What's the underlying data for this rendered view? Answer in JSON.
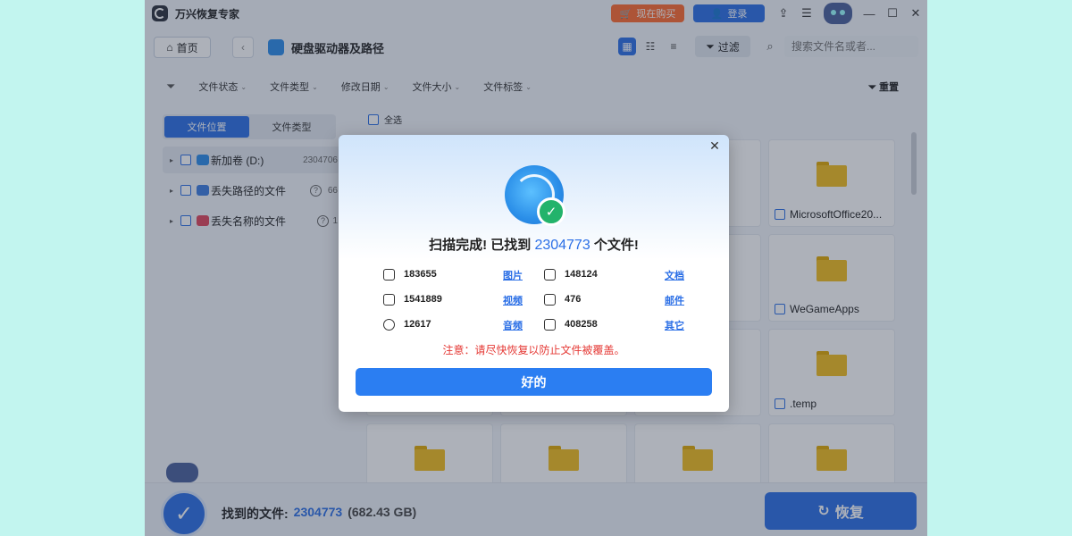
{
  "app": {
    "title": "万兴恢复专家",
    "buy_label": "现在购买",
    "login_label": "登录"
  },
  "nav": {
    "home_label": "首页",
    "title": "硬盘驱动器及路径",
    "filter_label": "过滤",
    "search_placeholder": "搜索文件名或者..."
  },
  "filters": {
    "items": [
      "文件状态",
      "文件类型",
      "修改日期",
      "文件大小",
      "文件标签"
    ],
    "reset_label": "重置"
  },
  "sidebar": {
    "tabs": [
      {
        "label": "文件位置",
        "active": true
      },
      {
        "label": "文件类型",
        "active": false
      }
    ],
    "items": [
      {
        "label": "新加卷 (D:)",
        "count": "2304706",
        "icon_color": "#2b8be8"
      },
      {
        "label": "丢失路径的文件",
        "count": "66",
        "icon_color": "#3d7de0"
      },
      {
        "label": "丢失名称的文件",
        "count": "1",
        "icon_color": "#e0455b"
      }
    ]
  },
  "grid": {
    "select_all_label": "全选",
    "visible_labels": [
      "MicrosoftOffice20...",
      "WeGameApps",
      ".temp"
    ]
  },
  "bottom": {
    "found_label": "找到的文件:",
    "found_count": "2304773",
    "found_size": "(682.43 GB)",
    "recover_label": "恢复"
  },
  "dialog": {
    "title_prefix": "扫描完成! 已找到",
    "title_count": "2304773",
    "title_suffix": "个文件!",
    "stats": [
      {
        "icon": "image-icon",
        "value": "183655",
        "link": "图片"
      },
      {
        "icon": "document-icon",
        "value": "148124",
        "link": "文档"
      },
      {
        "icon": "video-icon",
        "value": "1541889",
        "link": "视频"
      },
      {
        "icon": "mail-icon",
        "value": "476",
        "link": "邮件"
      },
      {
        "icon": "audio-icon",
        "value": "12617",
        "link": "音频"
      },
      {
        "icon": "other-files-icon",
        "value": "408258",
        "link": "其它"
      }
    ],
    "warning": "注意：请尽快恢复以防止文件被覆盖。",
    "ok_label": "好的"
  },
  "colors": {
    "accent": "#2b6fe6",
    "buy": "#ff6a2e",
    "warning": "#e53935",
    "success": "#23b36b",
    "folder": "#f3bd1c"
  }
}
